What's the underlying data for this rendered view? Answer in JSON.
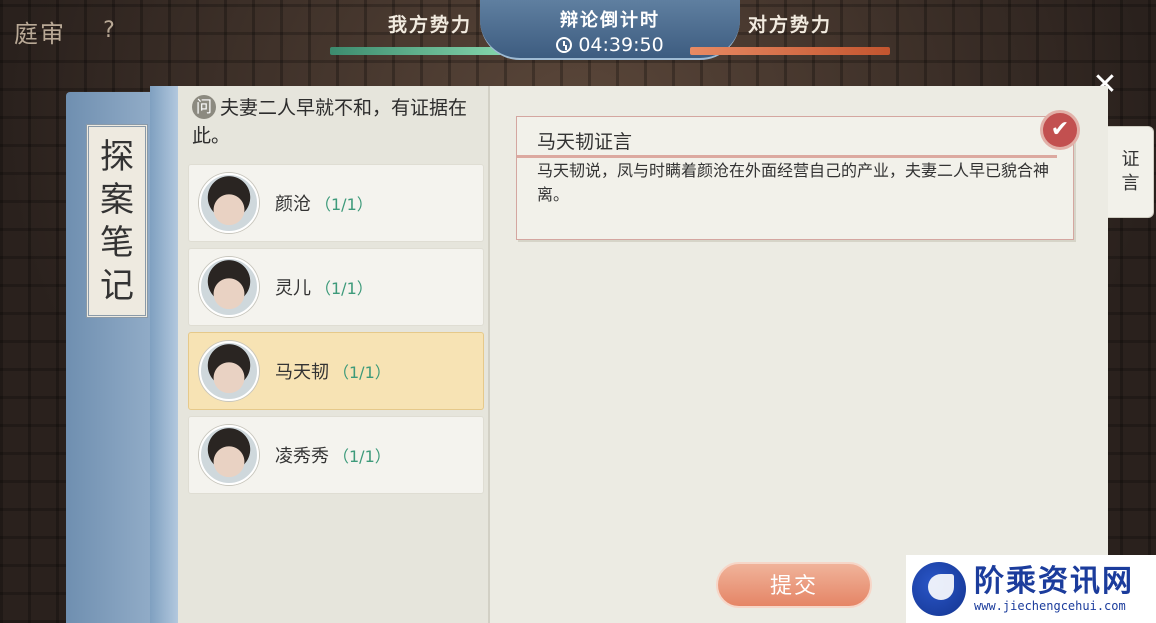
{
  "header": {
    "screen_title": "庭审",
    "help_label": "?"
  },
  "debate": {
    "our_side": "我方势力",
    "their_side": "对方势力",
    "timer_label": "辩论倒计时",
    "timer_value": "04:39:50"
  },
  "notebook": {
    "title_chars": [
      "探",
      "案",
      "笔",
      "记"
    ]
  },
  "question": {
    "badge": "问",
    "text": "夫妻二人早就不和，有证据在此。"
  },
  "characters": [
    {
      "name": "颜沧",
      "count": "（1/1）"
    },
    {
      "name": "灵儿",
      "count": "（1/1）"
    },
    {
      "name": "马天韧",
      "count": "（1/1）"
    },
    {
      "name": "凌秀秀",
      "count": "（1/1）"
    }
  ],
  "testimony": {
    "title": "马天韧证言",
    "text": "马天韧说，凤与时瞒着颜沧在外面经营自己的产业，夫妻二人早已貌合神离。",
    "check": "✔"
  },
  "side_tab": {
    "chars": [
      "证",
      "言"
    ]
  },
  "close_glyph": "✕",
  "submit_label": "提交",
  "watermark": {
    "name": "阶乘资讯网",
    "url": "www.jiechengcehui.com"
  },
  "colors": {
    "our_bar": "#8fe0b4",
    "their_bar": "#e88a63",
    "selected_row": "#f7e3b4",
    "count_green": "#3d9a7a",
    "submit": "#e58566"
  }
}
